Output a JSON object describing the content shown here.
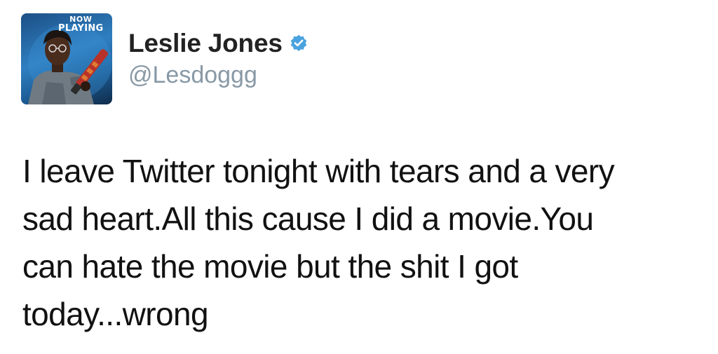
{
  "avatar": {
    "badge_line1": "NOW",
    "badge_line2": "PLAYING",
    "icon": "ghostbusters-poster-avatar"
  },
  "user": {
    "display_name": "Leslie Jones",
    "handle": "@Lesdoggg",
    "verified_icon": "verified-badge-icon",
    "verified_color": "#4aa3df"
  },
  "tweet": {
    "lines": [
      "I leave Twitter tonight with tears and a very",
      "sad heart.All this cause I did a movie.You",
      "can hate the movie but the shit I got",
      "today...wrong"
    ]
  },
  "colors": {
    "text": "#111111",
    "handle": "#8899a6",
    "background": "#ffffff"
  }
}
